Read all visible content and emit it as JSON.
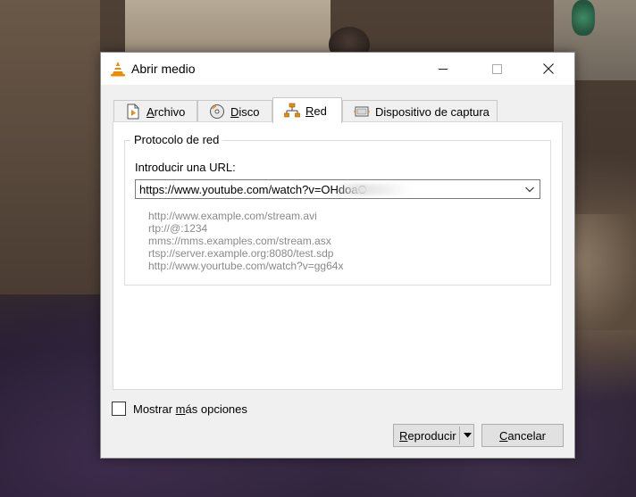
{
  "window": {
    "title": "Abrir medio"
  },
  "tabs": [
    {
      "label": "Archivo",
      "mnemonic": "A",
      "icon": "file-icon",
      "active": false
    },
    {
      "label": "Disco",
      "mnemonic": "D",
      "icon": "disc-icon",
      "active": false
    },
    {
      "label": "Red",
      "mnemonic": "R",
      "icon": "network-icon",
      "active": true
    },
    {
      "label": "Dispositivo de captura",
      "mnemonic": "",
      "icon": "capture-device-icon",
      "active": false
    }
  ],
  "network": {
    "group_title": "Protocolo de red",
    "url_label": "Introducir una URL:",
    "url_value": "https://www.youtube.com/watch?v=OHdoaO",
    "examples": [
      "http://www.example.com/stream.avi",
      "rtp://@:1234",
      "mms://mms.examples.com/stream.asx",
      "rtsp://server.example.org:8080/test.sdp",
      "http://www.yourtube.com/watch?v=gg64x"
    ]
  },
  "more_options": {
    "label": "Mostrar más opciones",
    "checked": false
  },
  "buttons": {
    "play": "Reproducir",
    "cancel": "Cancelar"
  },
  "colors": {
    "accent_orange": "#f08a00",
    "dialog_bg": "#f0f0f0",
    "button_bg": "#e1e1e1"
  }
}
